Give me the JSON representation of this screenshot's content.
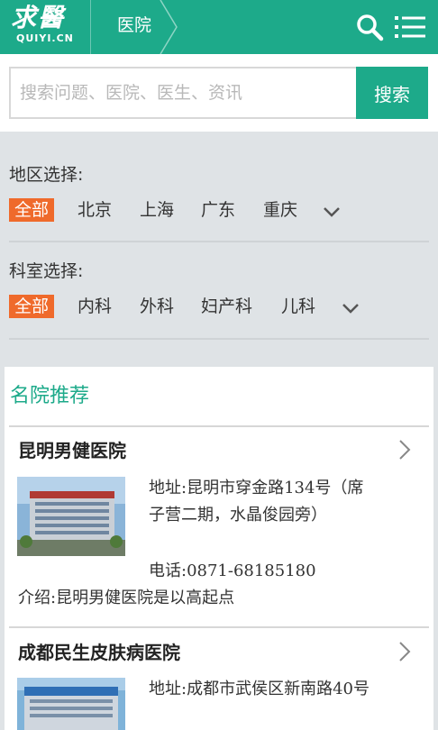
{
  "header": {
    "logo_text": "求醫",
    "logo_sub": "QUIYI.CN",
    "breadcrumb": "医院",
    "search_icon": "search-icon",
    "menu_icon": "hamburger-menu-icon",
    "bg_color": "#1daa8a"
  },
  "search": {
    "placeholder": "搜索问题、医院、医生、资讯",
    "value": "",
    "button_label": "搜索"
  },
  "filters": {
    "region": {
      "label": "地区选择:",
      "options": [
        "全部",
        "北京",
        "上海",
        "广东",
        "重庆"
      ],
      "selected": "全部",
      "more_icon": "chevron-down-icon"
    },
    "department": {
      "label": "科室选择:",
      "options": [
        "全部",
        "内科",
        "外科",
        "妇产科",
        "儿科"
      ],
      "selected": "全部",
      "more_icon": "chevron-down-icon"
    },
    "active_color": "#ef6a2b"
  },
  "recommend": {
    "title": "名院推荐",
    "hospitals": [
      {
        "name": "昆明男健医院",
        "address": "地址:昆明市穿金路134号（席子营二期，水晶俊园旁）",
        "phone": "电话:0871-68185180",
        "intro": "介绍:昆明男健医院是以高起点"
      },
      {
        "name": "成都民生皮肤病医院",
        "address": "地址:成都市武侯区新南路40号"
      }
    ]
  }
}
